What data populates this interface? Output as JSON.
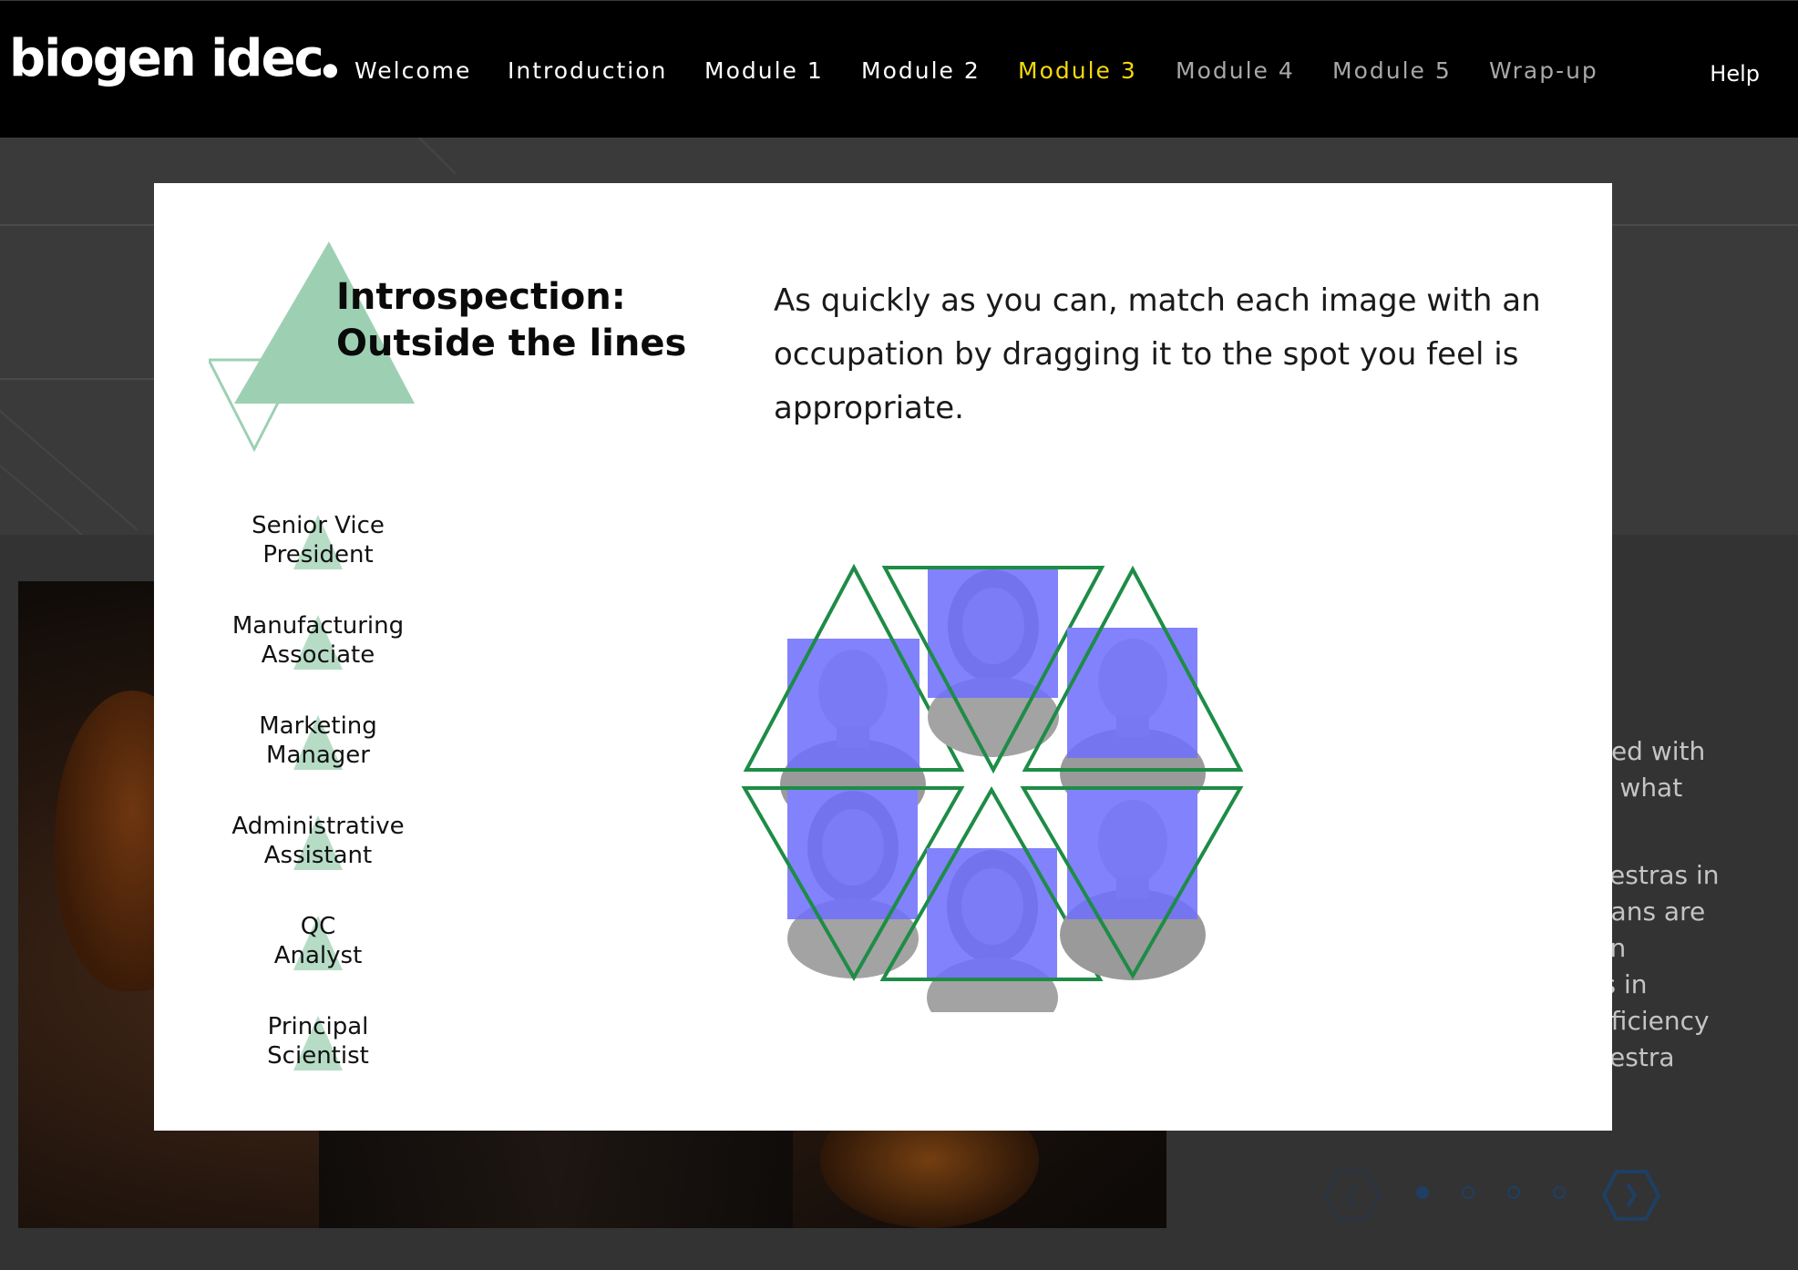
{
  "app": {
    "logo_text": "biogen idec",
    "help_label": "Help"
  },
  "nav": {
    "items": [
      {
        "label": "Welcome",
        "state": "normal"
      },
      {
        "label": "Introduction",
        "state": "normal"
      },
      {
        "label": "Module 1",
        "state": "normal"
      },
      {
        "label": "Module 2",
        "state": "normal"
      },
      {
        "label": "Module 3",
        "state": "active"
      },
      {
        "label": "Module 4",
        "state": "dim"
      },
      {
        "label": "Module 5",
        "state": "dim"
      },
      {
        "label": "Wrap-up",
        "state": "dim"
      }
    ]
  },
  "background_page": {
    "text_lines": [
      "ented with",
      "der what",
      "rchestras in",
      "sicians are",
      "men",
      "ries in",
      "proficiency",
      "rchestra"
    ],
    "carousel": {
      "prev_icon": "chevron-left-icon",
      "next_icon": "chevron-right-icon",
      "dots": 4,
      "active_dot": 1
    }
  },
  "modal": {
    "title_line1": "Introspection:",
    "title_line2": "Outside the lines",
    "instructions": "As quickly as you can, match each image with an occupation by dragging it to the spot you feel is appropriate.",
    "occupations": [
      {
        "line1": "Senior Vice",
        "line2": "President"
      },
      {
        "line1": "Manufacturing",
        "line2": "Associate"
      },
      {
        "line1": "Marketing",
        "line2": "Manager"
      },
      {
        "line1": "Administrative",
        "line2": "Assistant"
      },
      {
        "line1": "QC",
        "line2": "Analyst"
      },
      {
        "line1": "Principal",
        "line2": "Scientist"
      }
    ],
    "photos": [
      {
        "description_icon": "portrait-older-man-icon"
      },
      {
        "description_icon": "portrait-blonde-woman-icon"
      },
      {
        "description_icon": "portrait-asian-man-icon"
      },
      {
        "description_icon": "portrait-dark-hair-woman-icon"
      },
      {
        "description_icon": "portrait-older-woman-glasses-icon"
      },
      {
        "description_icon": "portrait-bald-man-icon"
      }
    ]
  },
  "colors": {
    "nav_active": "#f5d90a",
    "nav_dim": "#a8a8a8",
    "triangle_green": "#1e8c46",
    "triangle_mint": "#9dd0b3",
    "photo_overlay": "#6f6fff",
    "carousel_blue": "#1f3f63"
  }
}
